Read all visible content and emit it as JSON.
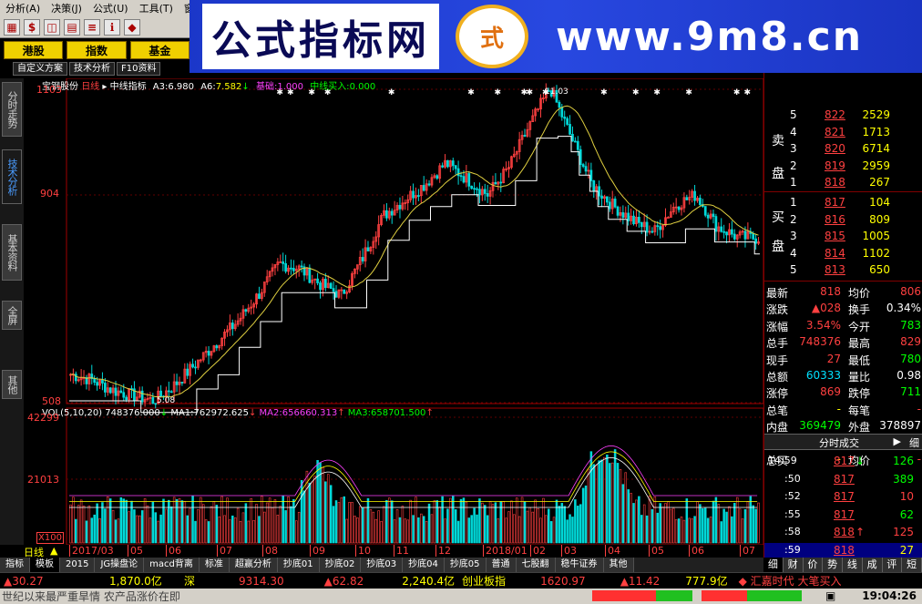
{
  "menubar": [
    "分析(A)",
    "决策(J)",
    "公式(U)",
    "工具(T)",
    "窗口"
  ],
  "banner": {
    "cn": "公式指标网",
    "logo": "式",
    "url": "www.9m8.cn"
  },
  "navtabs": [
    "港股",
    "指数",
    "基金"
  ],
  "subtabs": [
    "自定义方案",
    "技术分析",
    "F10资料"
  ],
  "vtabs": [
    "分时走势",
    "技术分析",
    "基本资料",
    "全屏",
    "其他"
  ],
  "chart": {
    "title": "宝钢股份",
    "period": "日线",
    "indicator": "中线指标",
    "a3_label": "A3:",
    "a3": "6.980",
    "a6_label": "A6:",
    "a6": "7.582",
    "base_label": "基础:",
    "base": "1.000",
    "buy_label": "中线买入:",
    "buy": "0.000",
    "y_top": "1103",
    "y_mid": "904",
    "y_low": "508",
    "high_mark": "11.03",
    "low_mark": "5.08",
    "vol_label": "VOL(5,10,20)",
    "vol": "748376.000",
    "ma1_label": "MA1:",
    "ma1": "762972.625",
    "ma2_label": "MA2:",
    "ma2": "656660.313",
    "ma3_label": "MA3:",
    "ma3": "658701.500",
    "vol_top": "42299",
    "vol_mid": "21013",
    "vol_unit": "X100",
    "x_period": "日线",
    "x_labels": [
      "2017/03",
      "05",
      "06",
      "07",
      "08",
      "09",
      "10",
      "11",
      "12",
      "2018/01",
      "02",
      "03",
      "04",
      "05",
      "06",
      "07"
    ],
    "chart_data": {
      "type": "candlestick",
      "y_range": [
        5.08,
        11.03
      ],
      "price_close_approx": [
        5.6,
        5.5,
        5.3,
        5.2,
        5.1,
        5.4,
        5.8,
        6.2,
        6.6,
        7.1,
        7.7,
        7.6,
        7.3,
        7.1,
        7.8,
        8.6,
        8.9,
        9.2,
        9.6,
        9.3,
        9.0,
        9.5,
        10.3,
        11.03,
        10.1,
        9.2,
        8.8,
        8.5,
        8.3,
        8.8,
        9.0,
        8.4,
        8.2,
        8.18
      ]
    }
  },
  "quote": {
    "sell_label": "卖",
    "pan_label": "盘",
    "buy_label": "买",
    "asks": [
      {
        "lvl": "5",
        "price": "822",
        "vol": "2529"
      },
      {
        "lvl": "4",
        "price": "821",
        "vol": "1713"
      },
      {
        "lvl": "3",
        "price": "820",
        "vol": "6714"
      },
      {
        "lvl": "2",
        "price": "819",
        "vol": "2959"
      },
      {
        "lvl": "1",
        "price": "818",
        "vol": "267"
      }
    ],
    "bids": [
      {
        "lvl": "1",
        "price": "817",
        "vol": "104"
      },
      {
        "lvl": "2",
        "price": "816",
        "vol": "809"
      },
      {
        "lvl": "3",
        "price": "815",
        "vol": "1005"
      },
      {
        "lvl": "4",
        "price": "814",
        "vol": "1102"
      },
      {
        "lvl": "5",
        "price": "813",
        "vol": "650"
      }
    ],
    "stats": [
      {
        "l": "最新",
        "v": "818",
        "l2": "均价",
        "v2": "806"
      },
      {
        "l": "涨跌",
        "v": "▲028",
        "l2": "换手",
        "v2": "0.34%"
      },
      {
        "l": "涨幅",
        "v": "3.54%",
        "l2": "今开",
        "v2": "783"
      },
      {
        "l": "总手",
        "v": "748376",
        "l2": "最高",
        "v2": "829"
      },
      {
        "l": "现手",
        "v": "27",
        "l2": "最低",
        "v2": "780"
      },
      {
        "l": "总额",
        "v": "60333",
        "l2": "量比",
        "v2": "0.98"
      },
      {
        "l": "涨停",
        "v": "869",
        "l2": "跌停",
        "v2": "711"
      },
      {
        "l": "总笔",
        "v": "-",
        "l2": "每笔",
        "v2": "-"
      },
      {
        "l": "内盘",
        "v": "369479",
        "l2": "外盘",
        "v2": "378897"
      },
      {
        "l": "总卖",
        "v": "-",
        "l2": "均价",
        "v2": "-"
      },
      {
        "l": "总买",
        "v": "-",
        "l2": "均价",
        "v2": "-"
      }
    ],
    "ticks_title": "分时成交",
    "ticks_detail": "细",
    "ticks": [
      {
        "t": "14:59",
        "p": "817",
        "arr": "↓",
        "v": "126"
      },
      {
        "t": ":50",
        "p": "817",
        "arr": "",
        "v": "389"
      },
      {
        "t": ":52",
        "p": "817",
        "arr": "",
        "v": "10"
      },
      {
        "t": ":55",
        "p": "817",
        "arr": "",
        "v": "62"
      },
      {
        "t": ":58",
        "p": "818",
        "arr": "↑",
        "v": "125"
      },
      {
        "t": ":59",
        "p": "818",
        "arr": "",
        "v": "27"
      }
    ],
    "rtabs": [
      "细",
      "财",
      "价",
      "势",
      "线",
      "成",
      "评",
      "短"
    ]
  },
  "btabs": [
    "指标",
    "模板",
    "2015",
    "JG操盘论",
    "macd背离",
    "标准",
    "超赢分析",
    "抄底01",
    "抄底02",
    "抄底03",
    "抄底04",
    "抄底05",
    "普通",
    "七股翻",
    "稳牛证券",
    "其他"
  ],
  "statusbar": {
    "s1": "▲30.27",
    "s2": "1,870.0亿",
    "s3": "深",
    "s4": "9314.30",
    "s5": "▲62.82",
    "s6": "2,240.4亿",
    "s7": "创业板指",
    "s8": "1620.97",
    "s9": "▲11.42",
    "s10": "777.9亿",
    "s11": "◆ 汇嘉时代 大笔买入"
  },
  "ticker": {
    "text": "世纪以来最严重旱情 农产品涨价在即",
    "time": "19:04:26"
  }
}
